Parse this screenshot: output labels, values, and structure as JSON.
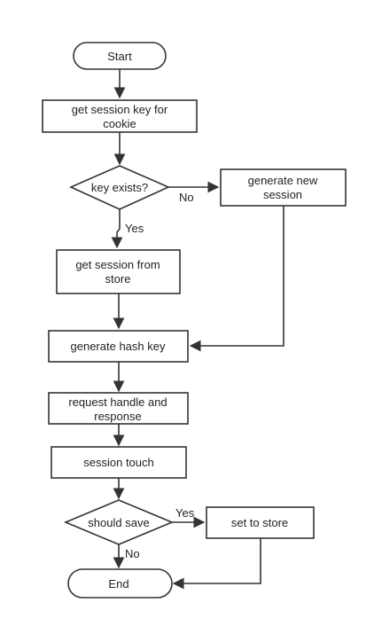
{
  "nodes": {
    "start": {
      "label": "Start"
    },
    "get_key": {
      "label": [
        "get session key for",
        "cookie"
      ]
    },
    "key_exists": {
      "label": "key exists?"
    },
    "generate_new": {
      "label": [
        "generate new",
        "session"
      ]
    },
    "get_from_store": {
      "label": [
        "get session from",
        "store"
      ]
    },
    "generate_hash": {
      "label": "generate hash key"
    },
    "request_handle": {
      "label": [
        "request handle and",
        "response"
      ]
    },
    "session_touch": {
      "label": "session touch"
    },
    "should_save": {
      "label": "should save"
    },
    "set_to_store": {
      "label": "set to store"
    },
    "end": {
      "label": "End"
    }
  },
  "edges": {
    "key_exists_no": "No",
    "key_exists_yes": "Yes",
    "should_save_yes": "Yes",
    "should_save_no": "No"
  },
  "colors": {
    "stroke": "#333333",
    "fill": "#ffffff",
    "text": "#222222"
  }
}
